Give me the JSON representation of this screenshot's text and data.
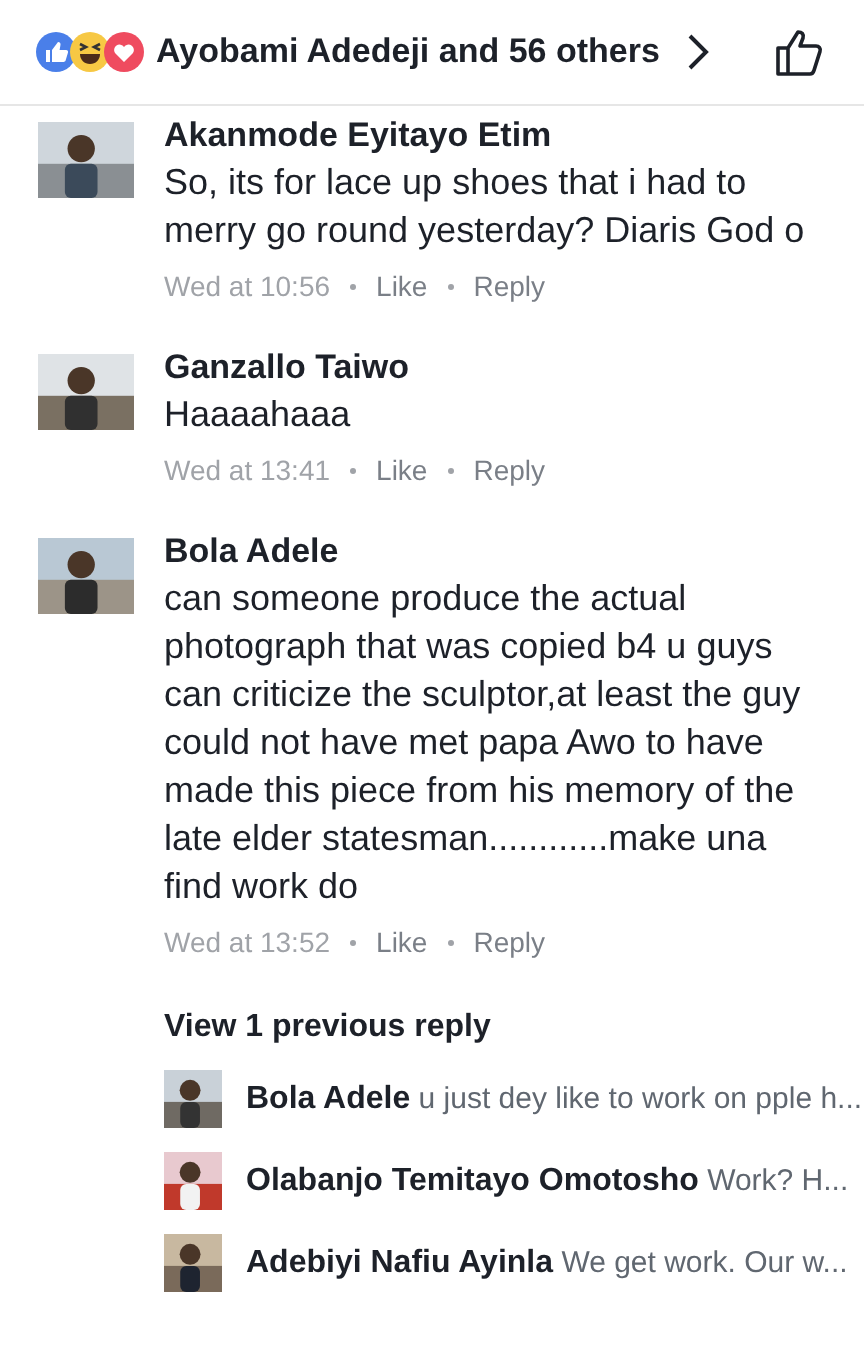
{
  "header": {
    "reactions_summary": "Ayobami Adedeji and 56 others"
  },
  "comments": [
    {
      "author": "Akanmode Eyitayo Etim",
      "text": "So, its for lace up shoes that i had to merry go round yesterday? Diaris God o",
      "time": "Wed at 10:56",
      "actions": [
        "Like",
        "Reply"
      ],
      "avatar": {
        "kind": "picture"
      }
    },
    {
      "author": "Ganzallo Taiwo",
      "text": "Haaaahaaa",
      "time": "Wed at 13:41",
      "actions": [
        "Like",
        "Reply"
      ],
      "avatar": {
        "kind": "picture"
      }
    },
    {
      "author": "Bola Adele",
      "text": "can someone produce the actual photograph that was copied b4 u guys can criticize the sculptor,at least the guy could not have met papa Awo to have made this piece from his memory of the late elder statesman............make una find work do",
      "time": "Wed at 13:52",
      "actions": [
        "Like",
        "Reply"
      ],
      "avatar": {
        "kind": "picture"
      }
    }
  ],
  "replies": {
    "view_previous": "View 1 previous reply",
    "items": [
      {
        "author": "Bola Adele",
        "preview": "u just dey like to work on pple h..."
      },
      {
        "author": "Olabanjo Temitayo Omotosho",
        "preview": "Work? H..."
      },
      {
        "author": "Adebiyi Nafiu Ayinla",
        "preview": "We get work. Our w..."
      }
    ]
  }
}
